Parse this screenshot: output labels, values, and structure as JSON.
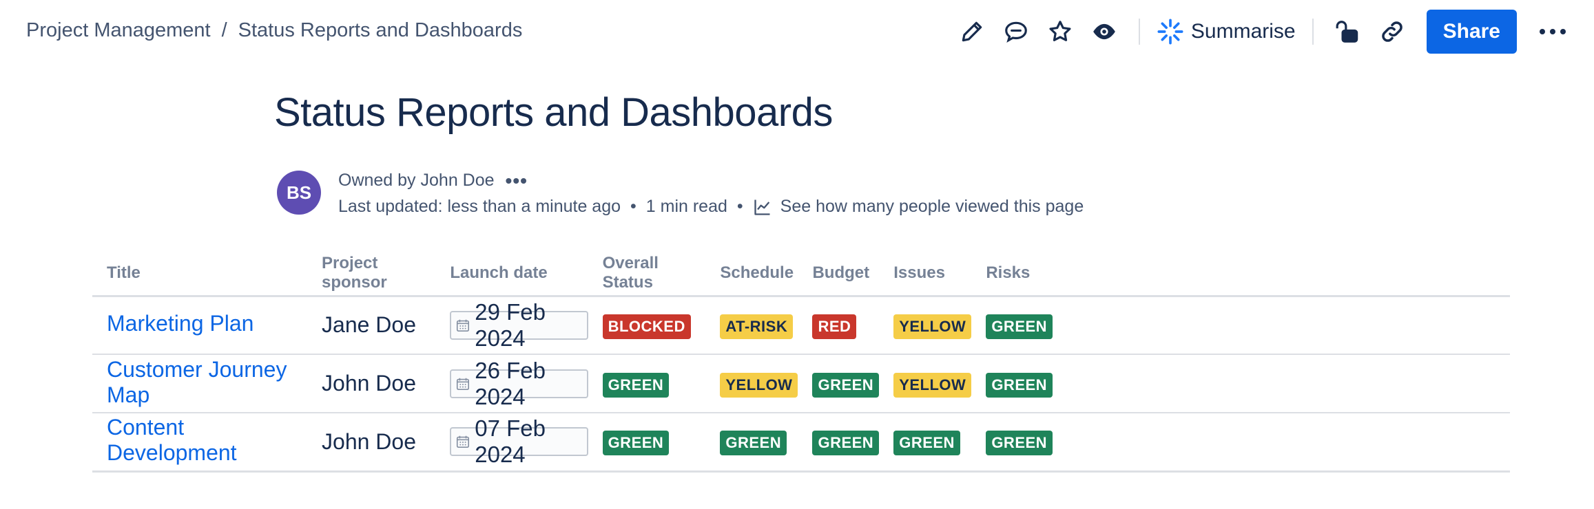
{
  "breadcrumb": {
    "parent": "Project Management",
    "separator": "/",
    "current": "Status Reports and Dashboards"
  },
  "toolbar": {
    "summarise_label": "Summarise",
    "share_label": "Share",
    "icons": [
      "pencil-icon",
      "comment-icon",
      "star-icon",
      "eye-icon",
      "sparkle-icon",
      "unlock-icon",
      "link-icon",
      "more-icon"
    ]
  },
  "page": {
    "title": "Status Reports and Dashboards"
  },
  "byline": {
    "avatar_initials": "BS",
    "owned_by": "Owned by John Doe",
    "more": "•••",
    "last_updated": "Last updated: less than a minute ago",
    "bullet": "•",
    "read_time": "1 min read",
    "views_link": "See how many people viewed this page"
  },
  "table": {
    "headers": [
      "Title",
      "Project sponsor",
      "Launch date",
      "Overall Status",
      "Schedule",
      "Budget",
      "Issues",
      "Risks"
    ],
    "rows": [
      {
        "title": "Marketing Plan",
        "sponsor": "Jane Doe",
        "launch_date": "29 Feb 2024",
        "overall": {
          "label": "BLOCKED",
          "color": "red"
        },
        "schedule": {
          "label": "AT-RISK",
          "color": "yellow"
        },
        "budget": {
          "label": "RED",
          "color": "red"
        },
        "issues": {
          "label": "YELLOW",
          "color": "yellow"
        },
        "risks": {
          "label": "GREEN",
          "color": "green"
        }
      },
      {
        "title": "Customer Journey Map",
        "sponsor": "John Doe",
        "launch_date": "26 Feb 2024",
        "overall": {
          "label": "GREEN",
          "color": "green"
        },
        "schedule": {
          "label": "YELLOW",
          "color": "yellow"
        },
        "budget": {
          "label": "GREEN",
          "color": "green"
        },
        "issues": {
          "label": "YELLOW",
          "color": "yellow"
        },
        "risks": {
          "label": "GREEN",
          "color": "green"
        }
      },
      {
        "title": "Content Development",
        "sponsor": "John Doe",
        "launch_date": "07 Feb 2024",
        "overall": {
          "label": "GREEN",
          "color": "green"
        },
        "schedule": {
          "label": "GREEN",
          "color": "green"
        },
        "budget": {
          "label": "GREEN",
          "color": "green"
        },
        "issues": {
          "label": "GREEN",
          "color": "green"
        },
        "risks": {
          "label": "GREEN",
          "color": "green"
        }
      }
    ]
  },
  "colors": {
    "primary": "#0c66e4",
    "red": "#c9372c",
    "green": "#1f845a",
    "yellow": "#f5cd47",
    "avatar": "#5e4db2"
  }
}
